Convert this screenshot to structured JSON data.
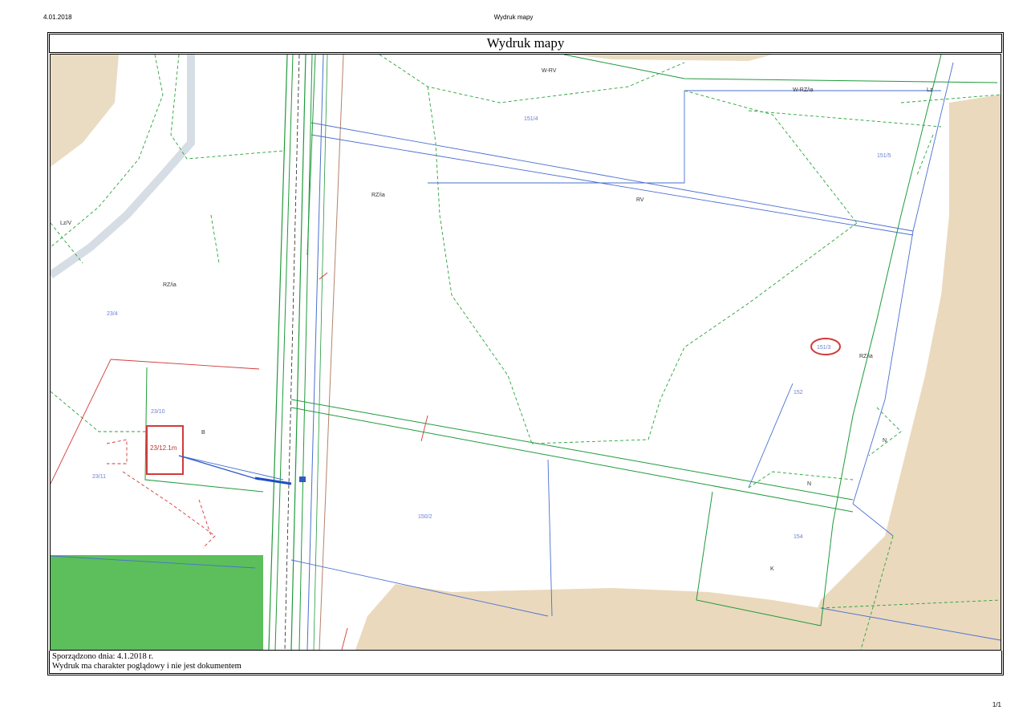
{
  "header": {
    "date": "4.01.2018",
    "title": "Wydruk mapy"
  },
  "frame": {
    "title": "Wydruk mapy"
  },
  "map": {
    "parcels": [
      {
        "id": "p-151-4",
        "label": "151/4"
      },
      {
        "id": "p-151-5",
        "label": "151/5"
      },
      {
        "id": "p-151-3",
        "label": "151/3"
      },
      {
        "id": "p-150-2",
        "label": "150/2"
      },
      {
        "id": "p-154",
        "label": "154"
      },
      {
        "id": "p-152",
        "label": "152"
      },
      {
        "id": "p-23-4",
        "label": "23/4"
      },
      {
        "id": "p-23-10",
        "label": "23/10"
      },
      {
        "id": "p-23-11",
        "label": "23/11"
      },
      {
        "id": "p-23-12",
        "label": "23/12.1m"
      }
    ],
    "land_use": [
      {
        "id": "u-rzvia-1",
        "label": "RZ/ia"
      },
      {
        "id": "u-rzvia-2",
        "label": "RZ/ia"
      },
      {
        "id": "u-rzvia-3",
        "label": "RZ/ia"
      },
      {
        "id": "u-rv",
        "label": "RV"
      },
      {
        "id": "u-wrzia",
        "label": "W-RZ/ia"
      },
      {
        "id": "u-lz",
        "label": "Lz"
      },
      {
        "id": "u-n1",
        "label": "N"
      },
      {
        "id": "u-n2",
        "label": "N"
      },
      {
        "id": "u-k",
        "label": "K"
      },
      {
        "id": "u-b",
        "label": "B"
      },
      {
        "id": "u-lzv",
        "label": "Lz/V"
      },
      {
        "id": "u-w",
        "label": "W-RV"
      }
    ],
    "colors": {
      "boundary_blue": "#4a6fd0",
      "landuse_green_dashed": "#2aa33a",
      "road_green": "#1f9a3a",
      "red_annotation": "#d23a3a",
      "tan_fill": "#ead9bd",
      "green_fill": "#5cbf5c",
      "road_grey": "#d6dde4"
    }
  },
  "footer": {
    "line1": "Sporządzono dnia: 4.1.2018 r.",
    "line2": "Wydruk ma charakter poglądowy i nie jest dokumentem"
  },
  "page_number": "1/1"
}
